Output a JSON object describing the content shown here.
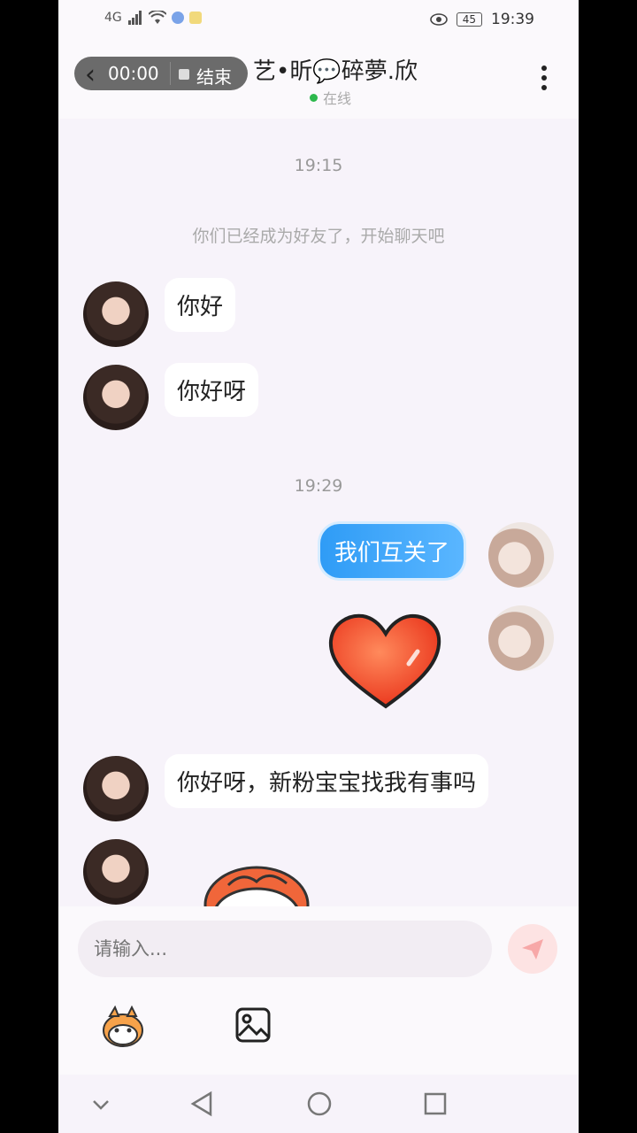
{
  "status_bar": {
    "network": "4G",
    "battery": "45",
    "time": "19:39"
  },
  "header": {
    "recording_time": "00:00",
    "recording_end_label": "结束",
    "title": "艺•昕💬碎夢.欣",
    "status": "在线"
  },
  "chat": {
    "timestamps": [
      "19:15",
      "19:29"
    ],
    "system_message": "你们已经成为好友了，开始聊天吧",
    "messages": [
      {
        "from": "them",
        "text": "你好"
      },
      {
        "from": "them",
        "text": "你好呀"
      },
      {
        "from": "me",
        "text": "我们互关了"
      },
      {
        "from": "me",
        "sticker": "heart-sticker"
      },
      {
        "from": "them",
        "text": "你好呀，新粉宝宝找我有事吗"
      },
      {
        "from": "them",
        "sticker": "cartoon-sticker"
      }
    ]
  },
  "composer": {
    "placeholder": "请输入..."
  },
  "colors": {
    "accent_blue": "#2f9cf6",
    "online_green": "#2db84d",
    "heart_red": "#f04a2a"
  }
}
